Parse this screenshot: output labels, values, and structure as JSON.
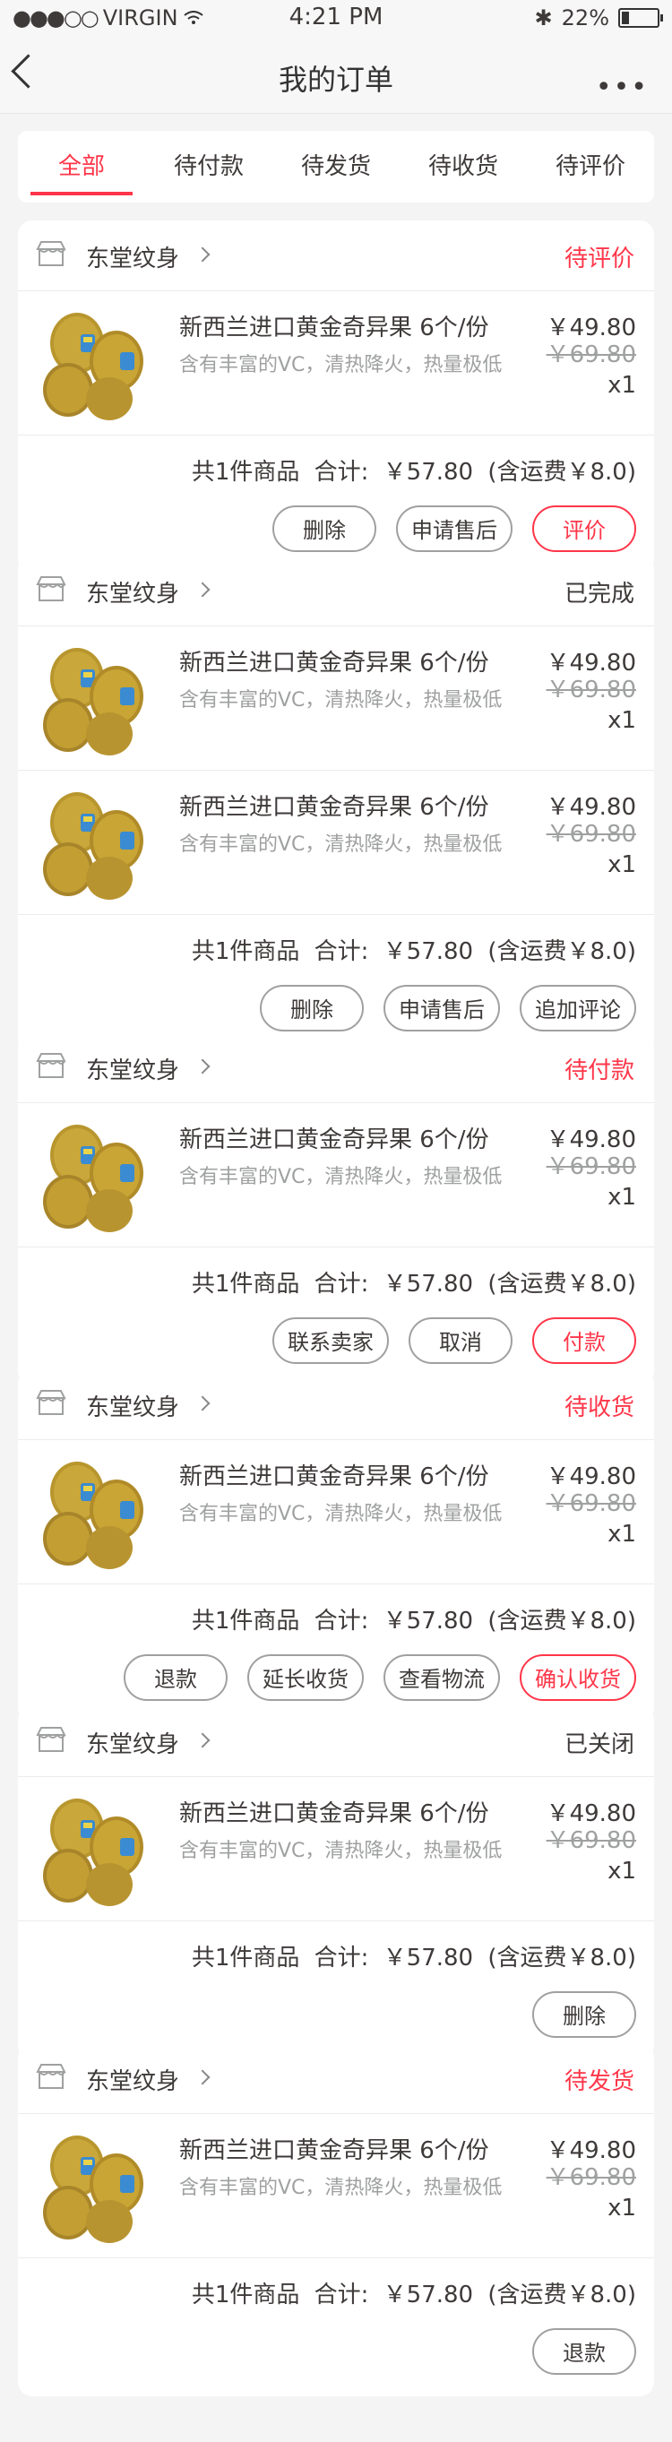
{
  "statusbar": {
    "signal": "●●●○○",
    "carrier": "VIRGIN",
    "time": "4:21 PM",
    "bluetooth": "✱",
    "battery": "22%"
  },
  "navbar": {
    "title": "我的订单",
    "more": "•••"
  },
  "tabs": [
    "全部",
    "待付款",
    "待发货",
    "待收货",
    "待评价"
  ],
  "colors": {
    "accent": "#ff3649",
    "text": "#3e3a39",
    "muted": "#9fa0a0"
  },
  "product": {
    "name": "新西兰进口黄金奇异果 6个/份",
    "desc": "含有丰富的VC，清热降火，热量极低",
    "price": "￥49.80",
    "orig_price": "￥69.80",
    "qty": "x1"
  },
  "orders": [
    {
      "shop": "东堂纹身",
      "status": "待评价",
      "status_red": true,
      "items": 1,
      "summary": {
        "count": "共1件商品",
        "total_label": "合计:",
        "total": "￥57.80",
        "shipping": "(含运费￥8.0)"
      },
      "buttons": [
        {
          "label": "删除",
          "red": false
        },
        {
          "label": "申请售后",
          "red": false
        },
        {
          "label": "评价",
          "red": true
        }
      ]
    },
    {
      "shop": "东堂纹身",
      "status": "已完成",
      "status_red": false,
      "items": 2,
      "summary": {
        "count": "共1件商品",
        "total_label": "合计:",
        "total": "￥57.80",
        "shipping": "(含运费￥8.0)"
      },
      "buttons": [
        {
          "label": "删除",
          "red": false
        },
        {
          "label": "申请售后",
          "red": false
        },
        {
          "label": "追加评论",
          "red": false
        }
      ]
    },
    {
      "shop": "东堂纹身",
      "status": "待付款",
      "status_red": true,
      "items": 1,
      "summary": {
        "count": "共1件商品",
        "total_label": "合计:",
        "total": "￥57.80",
        "shipping": "(含运费￥8.0)"
      },
      "buttons": [
        {
          "label": "联系卖家",
          "red": false
        },
        {
          "label": "取消",
          "red": false
        },
        {
          "label": "付款",
          "red": true
        }
      ]
    },
    {
      "shop": "东堂纹身",
      "status": "待收货",
      "status_red": true,
      "items": 1,
      "summary": {
        "count": "共1件商品",
        "total_label": "合计:",
        "total": "￥57.80",
        "shipping": "(含运费￥8.0)"
      },
      "buttons": [
        {
          "label": "退款",
          "red": false
        },
        {
          "label": "延长收货",
          "red": false
        },
        {
          "label": "查看物流",
          "red": false
        },
        {
          "label": "确认收货",
          "red": true
        }
      ]
    },
    {
      "shop": "东堂纹身",
      "status": "已关闭",
      "status_red": false,
      "items": 1,
      "summary": {
        "count": "共1件商品",
        "total_label": "合计:",
        "total": "￥57.80",
        "shipping": "(含运费￥8.0)"
      },
      "buttons": [
        {
          "label": "删除",
          "red": false
        }
      ]
    },
    {
      "shop": "东堂纹身",
      "status": "待发货",
      "status_red": true,
      "items": 1,
      "summary": {
        "count": "共1件商品",
        "total_label": "合计:",
        "total": "￥57.80",
        "shipping": "(含运费￥8.0)"
      },
      "buttons": [
        {
          "label": "退款",
          "red": false
        }
      ]
    }
  ]
}
